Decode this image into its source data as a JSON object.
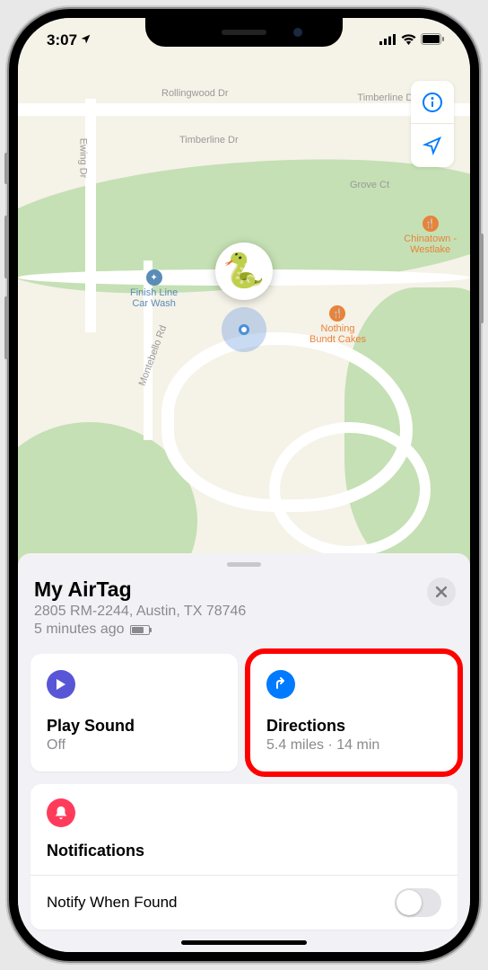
{
  "status_bar": {
    "time": "3:07",
    "location_indicator": "➤"
  },
  "map": {
    "labels": {
      "rollingwood": "Rollingwood Dr",
      "ewing": "Ewing Dr",
      "timberline": "Timberline Dr",
      "grove": "Grove Ct",
      "montebello": "Montebello Rd"
    },
    "pois": {
      "carwash": "Finish Line\nCar Wash",
      "cakes": "Nothing\nBundt Cakes",
      "chinatown": "Chinatown -\nWestlake"
    },
    "pin_emoji": "🐍"
  },
  "sheet": {
    "title": "My AirTag",
    "address": "2805 RM-2244, Austin, TX  78746",
    "timestamp": "5 minutes ago"
  },
  "cards": {
    "play_sound": {
      "title": "Play Sound",
      "sub": "Off"
    },
    "directions": {
      "title": "Directions",
      "sub": "5.4 miles · 14 min"
    }
  },
  "notifications": {
    "title": "Notifications",
    "row1": "Notify When Found"
  }
}
